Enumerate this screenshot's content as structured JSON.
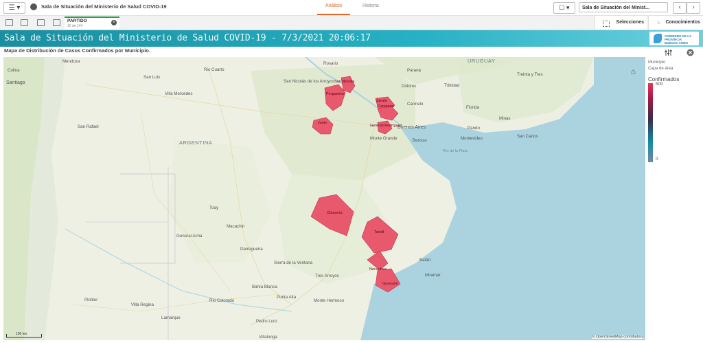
{
  "app": {
    "title": "Sala de Situación del Ministerio de Salud COVID-19",
    "tabs": [
      {
        "label": "Análisis",
        "active": true
      },
      {
        "label": "Historia",
        "active": false
      }
    ],
    "sheet_selector": "Sala de Situación del Minist...",
    "accent": "#e06a2c"
  },
  "toolbar": {
    "filter_chip": {
      "title": "PARTIDO",
      "subtitle": "10 de 144"
    },
    "selections_label": "Selecciones",
    "insights_label": "Conocimientos"
  },
  "header": {
    "title": "Sala de Situación del Ministerio de Salud COVID-19 - 7/3/2021 20:06:17",
    "logo_text": "BUENOS AIRES",
    "logo_subtext": "GOBIERNO DE LA PROVINCIA"
  },
  "chart": {
    "title": "Mapa de Distribución de Casos Confirmados por Municipio."
  },
  "map": {
    "place_labels": [
      "Colina",
      "Santiago",
      "Mendoza",
      "Rio Cuarto",
      "San Luis",
      "Villa Mercedes",
      "San Rafael",
      "ARGENTINA",
      "Rosario",
      "San Nicolás de los Arroyos",
      "Paraná",
      "Dolores",
      "Trinidad",
      "URUGUAY",
      "Treinta y Tres",
      "Carmelo",
      "Florida",
      "Minas",
      "Pando",
      "Montevideo",
      "San Carlos",
      "Monte Grande",
      "Berisso",
      "Río de la Plata",
      "Buenos Aires",
      "Toay",
      "Macachin",
      "General Acha",
      "Darregueira",
      "Sierra de la Ventana",
      "Tres Arroyos",
      "Bahía Blanca",
      "Punta Alta",
      "Monte Hermoso",
      "Plottier",
      "Villa Regina",
      "Rio Colorado",
      "Lamarque",
      "Pedro Luro",
      "Villalonga",
      "Batán",
      "Miramar"
    ],
    "municipalities": [
      {
        "name": "Pergamino",
        "color": "#e8596e"
      },
      {
        "name": "San Nicolás",
        "color": "#e8596e"
      },
      {
        "name": "Zárate",
        "color": "#e8596e"
      },
      {
        "name": "Campana",
        "color": "#e8596e"
      },
      {
        "name": "Junín",
        "color": "#e8596e"
      },
      {
        "name": "General Rodríguez",
        "color": "#e8596e"
      },
      {
        "name": "Olavarría",
        "color": "#e8596e"
      },
      {
        "name": "Tandil",
        "color": "#e8596e"
      },
      {
        "name": "Necochea",
        "color": "#e8596e"
      },
      {
        "name": "Quequén",
        "color": "#e8596e"
      }
    ],
    "scale_label": "100 km",
    "attribution": "© OpenStreetMap contributors",
    "home_icon": "home-icon"
  },
  "legend": {
    "dimension": "Municipio",
    "layer": "Capa de área",
    "measure": "Confirmados",
    "max": "500",
    "min": "0"
  }
}
